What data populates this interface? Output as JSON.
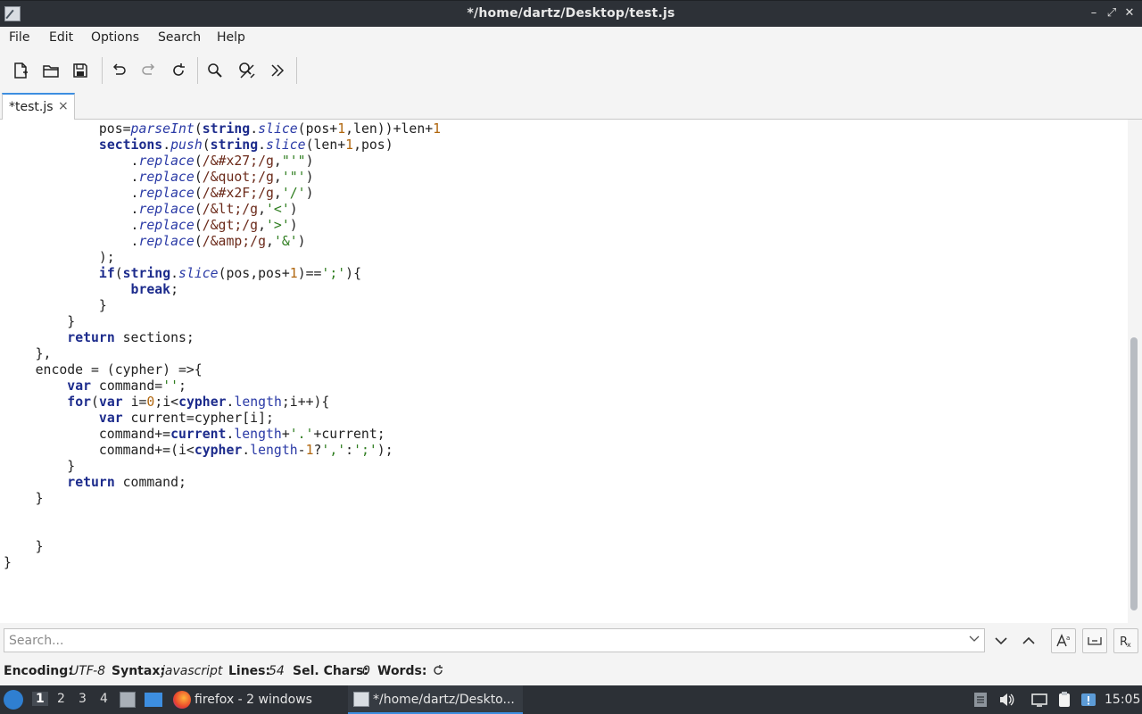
{
  "window": {
    "title": "*/home/dartz/Desktop/test.js"
  },
  "menu": [
    "File",
    "Edit",
    "Options",
    "Search",
    "Help"
  ],
  "toolbar": {
    "icons": [
      "new-document-icon",
      "open-folder-icon",
      "save-icon",
      "undo-icon",
      "redo-icon",
      "reload-icon",
      "search-icon",
      "find-replace-icon",
      "more-icon"
    ]
  },
  "tabs": [
    {
      "label": "*test.js",
      "close": "×"
    }
  ],
  "editor": {
    "lines": [
      "            pos=parseInt(string.slice(pos+1,len))+len+1",
      "            sections.push(string.slice(len+1,pos)",
      "                .replace(/&#x27;/g,\"'\")",
      "                .replace(/&quot;/g,'\"')",
      "                .replace(/&#x2F;/g,'/')",
      "                .replace(/&lt;/g,'<')",
      "                .replace(/&gt;/g,'>')",
      "                .replace(/&amp;/g,'&')",
      "            );",
      "            if(string.slice(pos,pos+1)==';'){",
      "                break;",
      "            }",
      "        }",
      "        return sections;",
      "    },",
      "    encode = (cypher) =>{",
      "        var command='';",
      "        for(var i=0;i<cypher.length;i++){",
      "            var current=cypher[i];",
      "            command+=current.length+'.'+current;",
      "            command+=(i<cypher.length-1?',':';');",
      "        }",
      "        return command;",
      "    }",
      "",
      "",
      "    }",
      "}"
    ]
  },
  "search": {
    "placeholder": "Search...",
    "value": "",
    "buttons": [
      "chevron-down-icon",
      "chevron-up-icon",
      "match-case-icon",
      "whole-word-icon",
      "regex-icon"
    ]
  },
  "status": {
    "encoding_label": "Encoding:",
    "encoding_value": "UTF-8",
    "syntax_label": "Syntax:",
    "syntax_value": "javascript",
    "lines_label": "Lines:",
    "lines_value": "54",
    "selchars_label": "Sel. Chars:",
    "selchars_value": "0",
    "words_label": "Words:"
  },
  "taskbar": {
    "workspaces": [
      "1",
      "2",
      "3",
      "4"
    ],
    "active_workspace": "1",
    "tasks": [
      {
        "label": "firefox - 2 windows",
        "icon": "firefox-icon"
      },
      {
        "label": "*/home/dartz/Deskto...",
        "icon": "text-editor-icon"
      }
    ],
    "clock": "15:05"
  }
}
